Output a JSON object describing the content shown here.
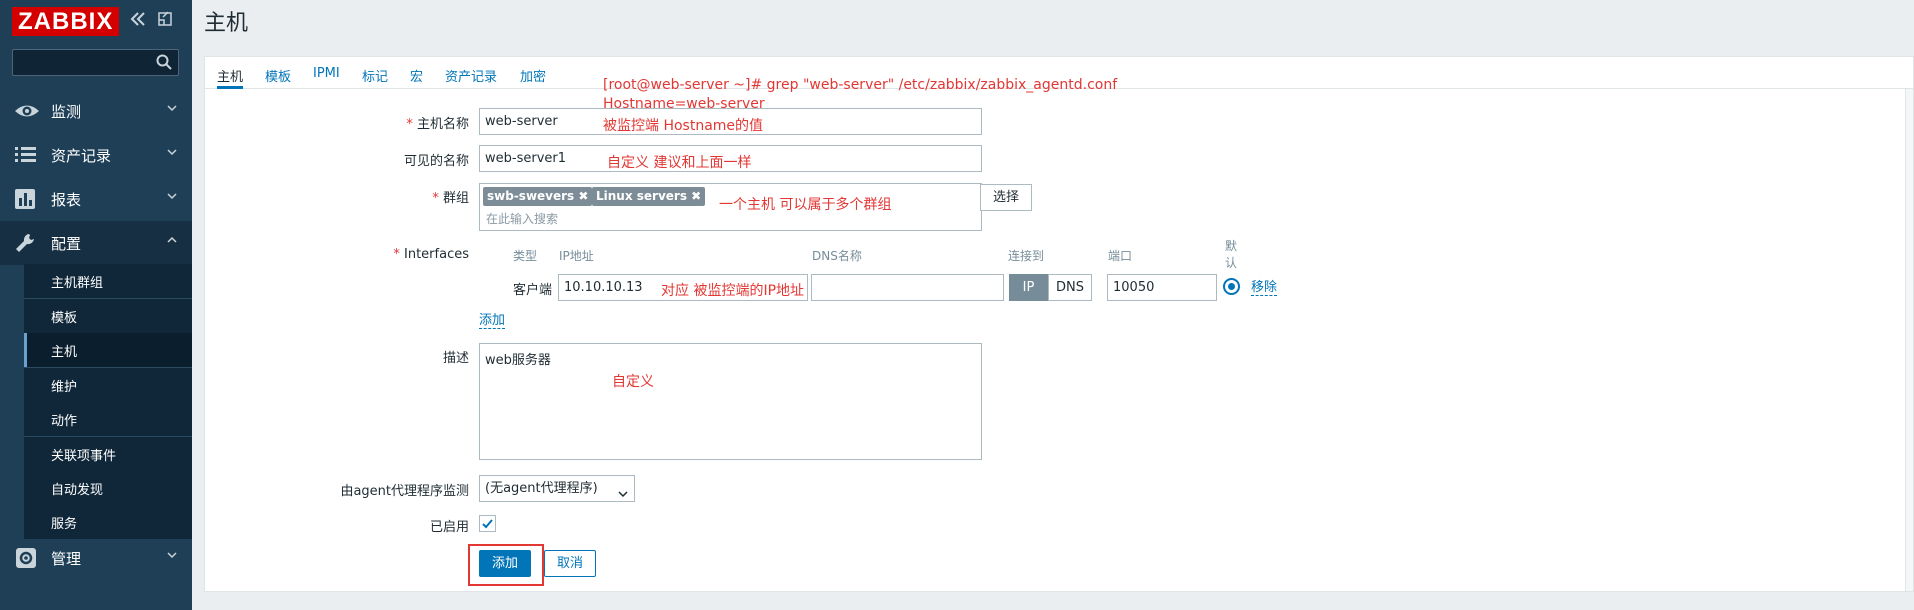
{
  "sidebar": {
    "logo": "ZABBIX",
    "collapse_icon": "double-chevron-left-icon",
    "kiosk_icon": "kiosk-icon",
    "search_icon": "search-icon",
    "menu": [
      {
        "label": "监测",
        "icon": "eye-icon"
      },
      {
        "label": "资产记录",
        "icon": "list-icon"
      },
      {
        "label": "报表",
        "icon": "bar-chart-icon"
      },
      {
        "label": "配置",
        "icon": "wrench-icon"
      },
      {
        "label": "管理",
        "icon": "gear-icon"
      }
    ],
    "submenu": [
      "主机群组",
      "模板",
      "主机",
      "维护",
      "动作",
      "关联项事件",
      "自动发现",
      "服务"
    ],
    "current_submenu": "主机"
  },
  "page": {
    "title": "主机"
  },
  "tabs": [
    "主机",
    "模板",
    "IPMI",
    "标记",
    "宏",
    "资产记录",
    "加密"
  ],
  "form": {
    "hostname_label": "主机名称",
    "hostname_value": "web-server",
    "visible_name_label": "可见的名称",
    "visible_name_value": "web-server1",
    "groups_label": "群组",
    "groups": [
      "swb-swevers",
      "Linux servers"
    ],
    "groups_placeholder": "在此输入搜索",
    "select_button": "选择",
    "interfaces_label": "Interfaces",
    "interface_headers": {
      "type": "类型",
      "ip": "IP地址",
      "dns": "DNS名称",
      "connect": "连接到",
      "port": "端口",
      "default": "默认"
    },
    "interface": {
      "type": "客户端",
      "ip": "10.10.10.13",
      "dns": "",
      "ip_btn": "IP",
      "dns_btn": "DNS",
      "port": "10050",
      "remove": "移除"
    },
    "add_interface": "添加",
    "description_label": "描述",
    "description_value": "web服务器",
    "proxy_label": "由agent代理程序监测",
    "proxy_value": "(无agent代理程序)",
    "enabled_label": "已启用",
    "enabled": true,
    "add_button": "添加",
    "cancel_button": "取消"
  },
  "annotations": {
    "a1": "[root@web-server ~]# grep \"web-server\" /etc/zabbix/zabbix_agentd.conf",
    "a2": "Hostname=web-server",
    "a3": "被监控端 Hostname的值",
    "a4": "自定义 建议和上面一样",
    "a5": "一个主机 可以属于多个群组",
    "a6": "对应 被监控端的IP地址",
    "a7": "自定义"
  },
  "colors": {
    "accent": "#0275b8",
    "sidebar": "#1f3f57",
    "logo": "#d40000",
    "annotation": "#e33734"
  }
}
